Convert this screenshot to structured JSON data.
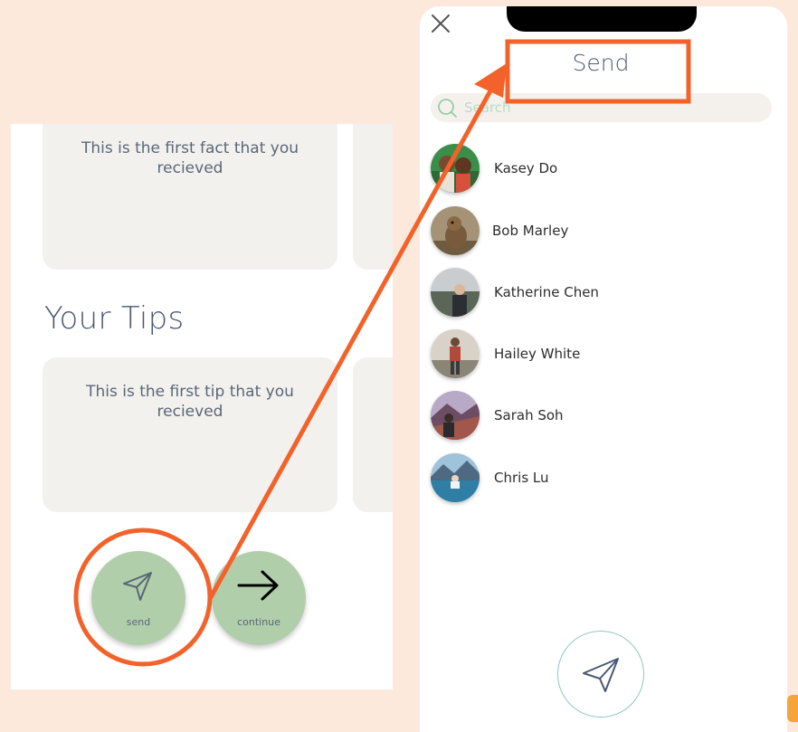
{
  "left": {
    "fact_card_text": "This is the first fact that you recieved",
    "section_title": "Your Tips",
    "tip_card_text": "This is the first tip that you recieved",
    "send_button_label": "send",
    "continue_button_label": "continue"
  },
  "right": {
    "title": "Send",
    "search_placeholder": "Search",
    "contacts": [
      {
        "name": "Kasey Do",
        "avatar": "people-photo"
      },
      {
        "name": "Bob Marley",
        "avatar": "squirrel-photo"
      },
      {
        "name": "Katherine Chen",
        "avatar": "person-landscape-photo"
      },
      {
        "name": "Hailey White",
        "avatar": "hiker-photo"
      },
      {
        "name": "Sarah Soh",
        "avatar": "mountain-view-photo"
      },
      {
        "name": "Chris Lu",
        "avatar": "lake-photo"
      }
    ]
  },
  "colors": {
    "background": "#fde9dc",
    "card": "#f3f1ee",
    "button_green": "#b1ceab",
    "annotation_orange": "#f2622a",
    "title_text": "#4b5a72"
  }
}
